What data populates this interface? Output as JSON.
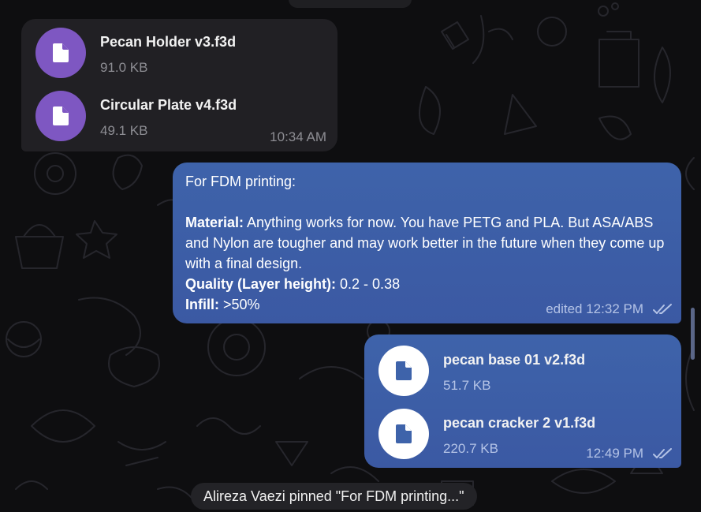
{
  "incoming_files": {
    "files": [
      {
        "name": "Pecan Holder v3.f3d",
        "size": "91.0 KB",
        "icon": "file-icon"
      },
      {
        "name": "Circular Plate v4.f3d",
        "size": "49.1 KB",
        "icon": "file-icon"
      }
    ],
    "time": "10:34 AM"
  },
  "text_message": {
    "intro": "For FDM printing:",
    "material_label": "Material:",
    "material_text": " Anything works for now. You have PETG and PLA. But ASA/ABS and Nylon are tougher and may work better in the future when they come up with a final design.",
    "quality_label": "Quality (Layer height):",
    "quality_text": " 0.2 - 0.38",
    "infill_label": "Infill:",
    "infill_text": " >50%",
    "meta": "edited 12:32 PM",
    "status_icon": "double-check-icon"
  },
  "outgoing_files": {
    "files": [
      {
        "name": "pecan base 01 v2.f3d",
        "size": "51.7 KB",
        "icon": "file-icon"
      },
      {
        "name": "pecan cracker 2 v1.f3d",
        "size": "220.7 KB",
        "icon": "file-icon"
      }
    ],
    "time": "12:49 PM",
    "status_icon": "double-check-icon"
  },
  "service_message": "Alireza Vaezi pinned \"For FDM printing...\"",
  "colors": {
    "background": "#0e0e10",
    "incoming_bubble": "#212024",
    "outgoing_bubble": "#3e63aa",
    "file_icon_incoming": "#7e57c2"
  }
}
